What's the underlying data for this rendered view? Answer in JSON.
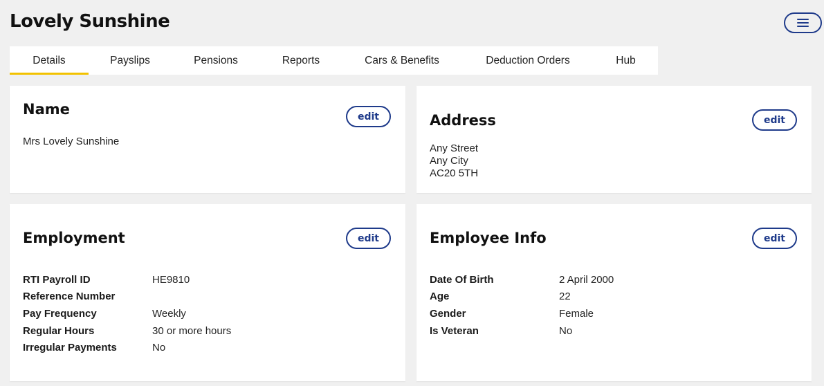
{
  "header": {
    "title": "Lovely Sunshine",
    "menu_icon": "hamburger-menu-icon"
  },
  "tabs": [
    {
      "label": "Details",
      "active": true
    },
    {
      "label": "Payslips"
    },
    {
      "label": "Pensions"
    },
    {
      "label": "Reports"
    },
    {
      "label": "Cars & Benefits"
    },
    {
      "label": "Deduction Orders"
    },
    {
      "label": "Hub"
    }
  ],
  "colors": {
    "accent": "#1e3a8a",
    "active_tab_underline": "#f2c200",
    "background": "#f0f0f0"
  },
  "name_card": {
    "title": "Name",
    "edit_label": "edit",
    "value": "Mrs Lovely Sunshine"
  },
  "address_card": {
    "title": "Address",
    "edit_label": "edit",
    "lines": [
      "Any Street",
      "Any City",
      "AC20 5TH"
    ]
  },
  "employment_card": {
    "title": "Employment",
    "edit_label": "edit",
    "rows": [
      {
        "key": "RTI Payroll ID",
        "value": "HE9810"
      },
      {
        "key": "Reference Number",
        "value": ""
      },
      {
        "key": "Pay Frequency",
        "value": "Weekly"
      },
      {
        "key": "Regular Hours",
        "value": "30 or more hours"
      },
      {
        "key": "Irregular Payments",
        "value": "No"
      }
    ]
  },
  "employee_info_card": {
    "title": "Employee Info",
    "edit_label": "edit",
    "rows": [
      {
        "key": "Date Of Birth",
        "value": "2 April 2000"
      },
      {
        "key": "Age",
        "value": "22"
      },
      {
        "key": "Gender",
        "value": "Female"
      },
      {
        "key": "Is Veteran",
        "value": "No"
      }
    ]
  }
}
